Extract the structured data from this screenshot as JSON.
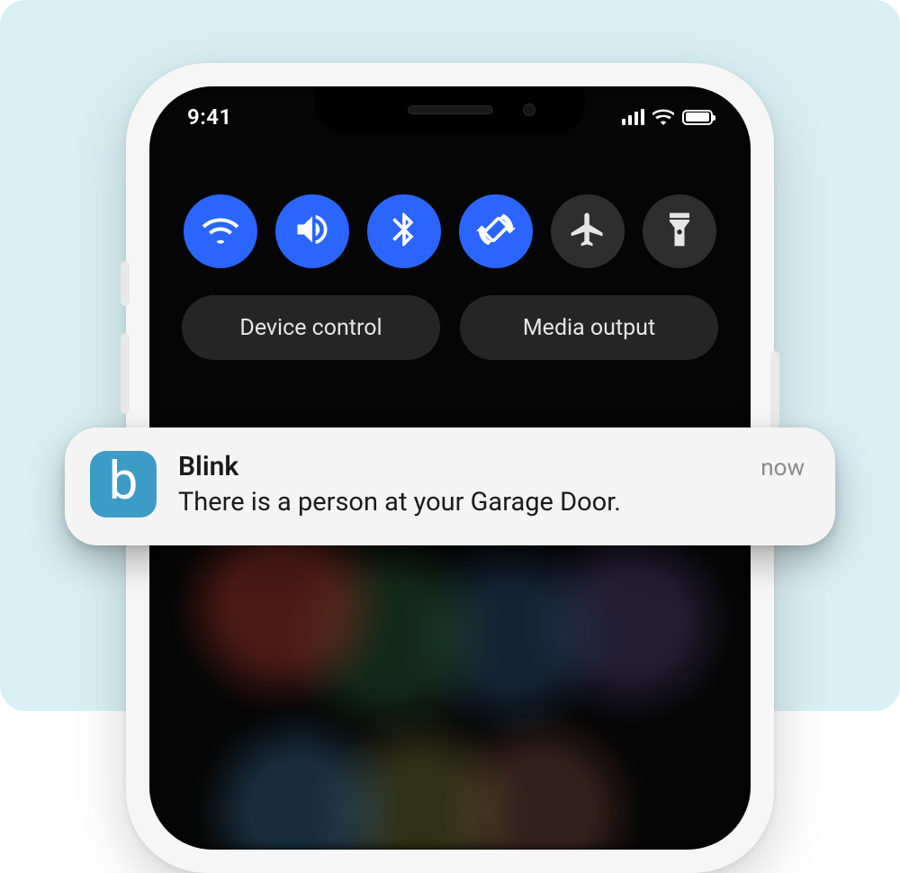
{
  "status_bar": {
    "time": "9:41"
  },
  "quick_settings": {
    "toggles": [
      {
        "id": "wifi",
        "on": true
      },
      {
        "id": "sound",
        "on": true
      },
      {
        "id": "bluetooth",
        "on": true
      },
      {
        "id": "rotate",
        "on": true
      },
      {
        "id": "airplane",
        "on": false
      },
      {
        "id": "flashlight",
        "on": false
      }
    ],
    "pill_a": "Device control",
    "pill_b": "Media output"
  },
  "notification": {
    "app_icon_letter": "b",
    "app_name": "Blink",
    "time": "now",
    "message": "There is a person at your Garage Door."
  },
  "colors": {
    "page_bg": "#d8f0f4",
    "toggle_on": "#2a65ff",
    "notif_icon_bg": "#3d9cc6"
  }
}
